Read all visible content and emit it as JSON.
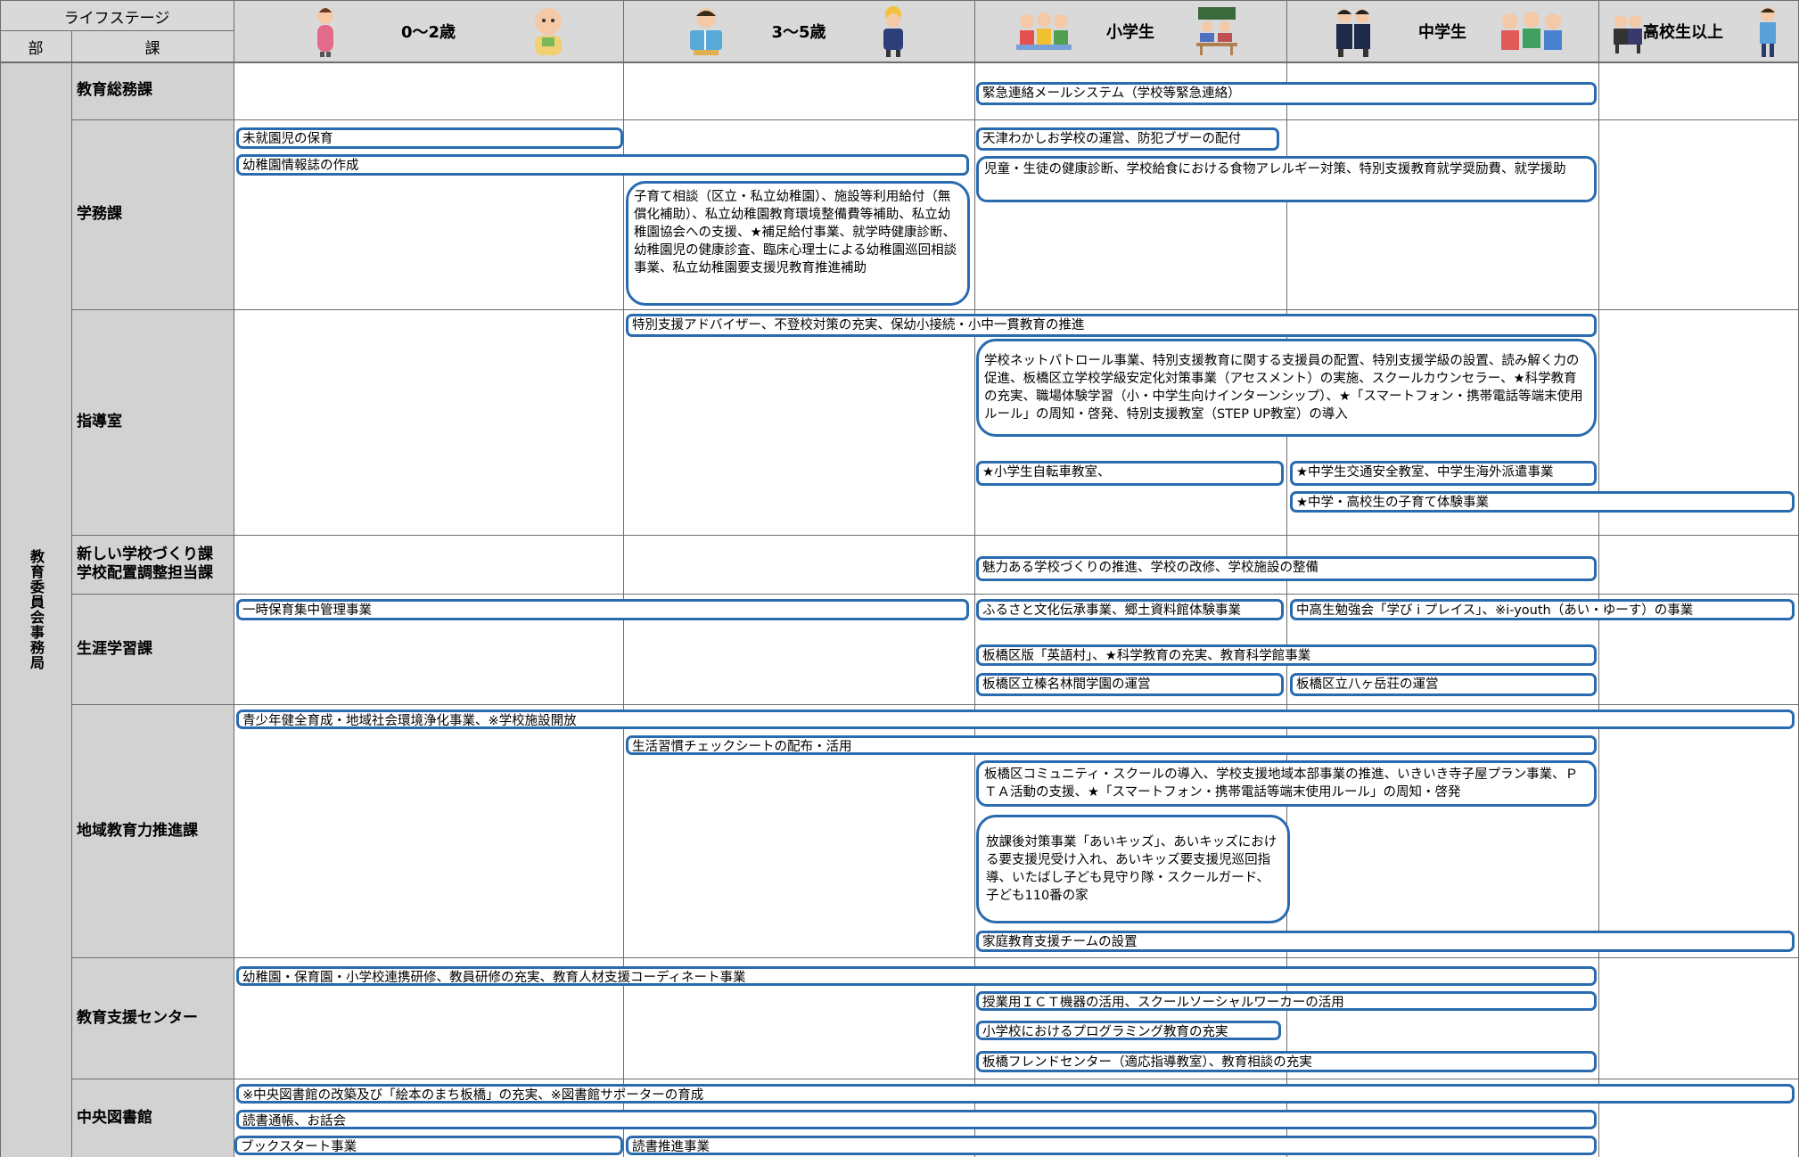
{
  "header": {
    "life_stage_label": "ライフステージ",
    "bu_label": "部",
    "ka_label": "課",
    "stages": [
      "0〜2歳",
      "3〜5歳",
      "小学生",
      "中学生",
      "高校生以上"
    ]
  },
  "bureau": "教育委員会事務局",
  "departments": [
    "教育総務課",
    "学務課",
    "指導室",
    "新しい学校づくり課\n学校配置調整担当課",
    "生涯学習課",
    "地域教育力推進課",
    "教育支援センター",
    "中央図書館"
  ],
  "items": {
    "somu_1": "緊急連絡メールシステム（学校等緊急連絡）",
    "gakumu_1": "未就園児の保育",
    "gakumu_2": "天津わかしお学校の運営、防犯ブザーの配付",
    "gakumu_3": "幼稚園情報誌の作成",
    "gakumu_4": "児童・生徒の健康診断、学校給食における食物アレルギー対策、特別支援教育就学奨励費、就学援助",
    "gakumu_5": "子育て相談（区立・私立幼稚園）、施設等利用給付（無償化補助）、私立幼稚園教育環境整備費等補助、私立幼稚園協会への支援、★補足給付事業、就学時健康診断、幼稚園児の健康診査、臨床心理士による幼稚園巡回相談事業、私立幼稚園要支援児教育推進補助",
    "shido_1": "特別支援アドバイザー、不登校対策の充実、保幼小接続・小中一貫教育の推進",
    "shido_2": "学校ネットパトロール事業、特別支援教育に関する支援員の配置、特別支援学級の設置、読み解く力の促進、板橋区立学校学級安定化対策事業（アセスメント）の実施、スクールカウンセラー、★科学教育の充実、職場体験学習（小・中学生向けインターンシップ）、★「スマートフォン・携帯電話等端末使用ルール」の周知・啓発、特別支援教室（STEP UP教室）の導入",
    "shido_3": "★小学生自転車教室、",
    "shido_4": "★中学生交通安全教室、中学生海外派遣事業",
    "shido_5": "★中学・高校生の子育て体験事業",
    "atarashii_1": "魅力ある学校づくりの推進、学校の改修、学校施設の整備",
    "shogai_1": "一時保育集中管理事業",
    "shogai_2": "ふるさと文化伝承事業、郷土資料館体験事業",
    "shogai_3": "中高生勉強会「学び i プレイス」、※i-youth（あい・ゆーす）の事業",
    "shogai_4": "板橋区版「英語村」、★科学教育の充実、教育科学館事業",
    "shogai_5": "板橋区立榛名林間学園の運営",
    "shogai_6": "板橋区立八ヶ岳荘の運営",
    "chiiki_1": "青少年健全育成・地域社会環境浄化事業、※学校施設開放",
    "chiiki_2": "生活習慣チェックシートの配布・活用",
    "chiiki_3": "板橋区コミュニティ・スクールの導入、学校支援地域本部事業の推進、いきいき寺子屋プラン事業、ＰＴＡ活動の支援、★「スマートフォン・携帯電話等端末使用ルール」の周知・啓発",
    "chiiki_4": "放課後対策事業「あいキッズ」、あいキッズにおける要支援児受け入れ、あいキッズ要支援児巡回指導、いたばし子ども見守り隊・スクールガード、子ども110番の家",
    "chiiki_5": "家庭教育支援チームの設置",
    "shien_1": "幼稚園・保育園・小学校連携研修、教員研修の充実、教育人材支援コーディネート事業",
    "shien_2": "授業用ＩＣＴ機器の活用、スクールソーシャルワーカーの活用",
    "shien_3": "小学校におけるプログラミング教育の充実",
    "shien_4": "板橋フレンドセンター（適応指導教室）、教育相談の充実",
    "tosho_1": "※中央図書館の改築及び「絵本のまち板橋」の充実、※図書館サポーターの育成",
    "tosho_2": "読書通帳、お話会",
    "tosho_3": "ブックスタート事業",
    "tosho_4": "読書推進事業"
  },
  "colors": {
    "box_border": "#2a6bb0",
    "header_bg": "#d9d9d9",
    "dept_bg": "#d2d2d2",
    "grid": "#6d6d6d"
  }
}
